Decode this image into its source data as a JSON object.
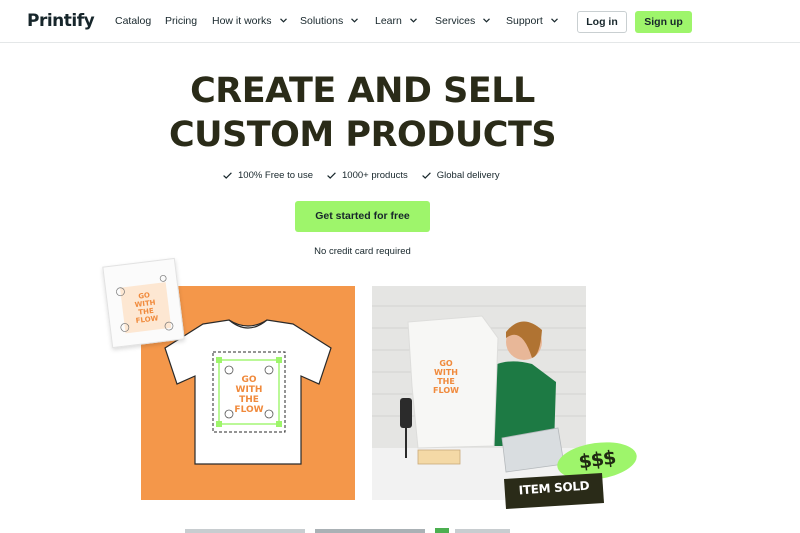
{
  "brand": {
    "logo": "Printify",
    "accent": "#9ef56b",
    "dark": "#17262b",
    "orange": "#f4974a"
  },
  "nav": {
    "items": [
      {
        "label": "Catalog",
        "has_dropdown": false
      },
      {
        "label": "Pricing",
        "has_dropdown": false
      },
      {
        "label": "How it works",
        "has_dropdown": true
      },
      {
        "label": "Solutions",
        "has_dropdown": true
      },
      {
        "label": "Learn",
        "has_dropdown": true
      },
      {
        "label": "Services",
        "has_dropdown": true
      },
      {
        "label": "Support",
        "has_dropdown": true
      }
    ],
    "login": "Log in",
    "signup": "Sign up"
  },
  "hero": {
    "title_line1": "CREATE AND SELL",
    "title_line2": "CUSTOM PRODUCTS",
    "features": [
      "100% Free to use",
      "1000+ products",
      "Global delivery"
    ],
    "cta": "Get started for free",
    "note": "No credit card required"
  },
  "showcase": {
    "design_text": [
      "GO",
      "WITH",
      "THE",
      "FLOW"
    ],
    "badge_price": "$$$",
    "badge_sold": "ITEM SOLD"
  }
}
